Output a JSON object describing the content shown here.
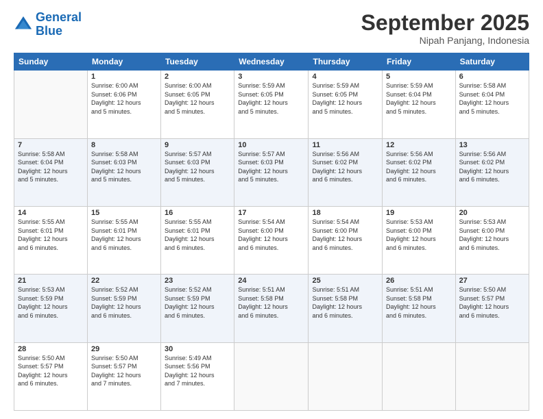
{
  "logo": {
    "text_general": "General",
    "text_blue": "Blue"
  },
  "header": {
    "month_year": "September 2025",
    "location": "Nipah Panjang, Indonesia"
  },
  "days_of_week": [
    "Sunday",
    "Monday",
    "Tuesday",
    "Wednesday",
    "Thursday",
    "Friday",
    "Saturday"
  ],
  "weeks": [
    [
      {
        "day": "",
        "info": ""
      },
      {
        "day": "1",
        "info": "Sunrise: 6:00 AM\nSunset: 6:06 PM\nDaylight: 12 hours\nand 5 minutes."
      },
      {
        "day": "2",
        "info": "Sunrise: 6:00 AM\nSunset: 6:05 PM\nDaylight: 12 hours\nand 5 minutes."
      },
      {
        "day": "3",
        "info": "Sunrise: 5:59 AM\nSunset: 6:05 PM\nDaylight: 12 hours\nand 5 minutes."
      },
      {
        "day": "4",
        "info": "Sunrise: 5:59 AM\nSunset: 6:05 PM\nDaylight: 12 hours\nand 5 minutes."
      },
      {
        "day": "5",
        "info": "Sunrise: 5:59 AM\nSunset: 6:04 PM\nDaylight: 12 hours\nand 5 minutes."
      },
      {
        "day": "6",
        "info": "Sunrise: 5:58 AM\nSunset: 6:04 PM\nDaylight: 12 hours\nand 5 minutes."
      }
    ],
    [
      {
        "day": "7",
        "info": "Sunrise: 5:58 AM\nSunset: 6:04 PM\nDaylight: 12 hours\nand 5 minutes."
      },
      {
        "day": "8",
        "info": "Sunrise: 5:58 AM\nSunset: 6:03 PM\nDaylight: 12 hours\nand 5 minutes."
      },
      {
        "day": "9",
        "info": "Sunrise: 5:57 AM\nSunset: 6:03 PM\nDaylight: 12 hours\nand 5 minutes."
      },
      {
        "day": "10",
        "info": "Sunrise: 5:57 AM\nSunset: 6:03 PM\nDaylight: 12 hours\nand 5 minutes."
      },
      {
        "day": "11",
        "info": "Sunrise: 5:56 AM\nSunset: 6:02 PM\nDaylight: 12 hours\nand 6 minutes."
      },
      {
        "day": "12",
        "info": "Sunrise: 5:56 AM\nSunset: 6:02 PM\nDaylight: 12 hours\nand 6 minutes."
      },
      {
        "day": "13",
        "info": "Sunrise: 5:56 AM\nSunset: 6:02 PM\nDaylight: 12 hours\nand 6 minutes."
      }
    ],
    [
      {
        "day": "14",
        "info": "Sunrise: 5:55 AM\nSunset: 6:01 PM\nDaylight: 12 hours\nand 6 minutes."
      },
      {
        "day": "15",
        "info": "Sunrise: 5:55 AM\nSunset: 6:01 PM\nDaylight: 12 hours\nand 6 minutes."
      },
      {
        "day": "16",
        "info": "Sunrise: 5:55 AM\nSunset: 6:01 PM\nDaylight: 12 hours\nand 6 minutes."
      },
      {
        "day": "17",
        "info": "Sunrise: 5:54 AM\nSunset: 6:00 PM\nDaylight: 12 hours\nand 6 minutes."
      },
      {
        "day": "18",
        "info": "Sunrise: 5:54 AM\nSunset: 6:00 PM\nDaylight: 12 hours\nand 6 minutes."
      },
      {
        "day": "19",
        "info": "Sunrise: 5:53 AM\nSunset: 6:00 PM\nDaylight: 12 hours\nand 6 minutes."
      },
      {
        "day": "20",
        "info": "Sunrise: 5:53 AM\nSunset: 6:00 PM\nDaylight: 12 hours\nand 6 minutes."
      }
    ],
    [
      {
        "day": "21",
        "info": "Sunrise: 5:53 AM\nSunset: 5:59 PM\nDaylight: 12 hours\nand 6 minutes."
      },
      {
        "day": "22",
        "info": "Sunrise: 5:52 AM\nSunset: 5:59 PM\nDaylight: 12 hours\nand 6 minutes."
      },
      {
        "day": "23",
        "info": "Sunrise: 5:52 AM\nSunset: 5:59 PM\nDaylight: 12 hours\nand 6 minutes."
      },
      {
        "day": "24",
        "info": "Sunrise: 5:51 AM\nSunset: 5:58 PM\nDaylight: 12 hours\nand 6 minutes."
      },
      {
        "day": "25",
        "info": "Sunrise: 5:51 AM\nSunset: 5:58 PM\nDaylight: 12 hours\nand 6 minutes."
      },
      {
        "day": "26",
        "info": "Sunrise: 5:51 AM\nSunset: 5:58 PM\nDaylight: 12 hours\nand 6 minutes."
      },
      {
        "day": "27",
        "info": "Sunrise: 5:50 AM\nSunset: 5:57 PM\nDaylight: 12 hours\nand 6 minutes."
      }
    ],
    [
      {
        "day": "28",
        "info": "Sunrise: 5:50 AM\nSunset: 5:57 PM\nDaylight: 12 hours\nand 6 minutes."
      },
      {
        "day": "29",
        "info": "Sunrise: 5:50 AM\nSunset: 5:57 PM\nDaylight: 12 hours\nand 7 minutes."
      },
      {
        "day": "30",
        "info": "Sunrise: 5:49 AM\nSunset: 5:56 PM\nDaylight: 12 hours\nand 7 minutes."
      },
      {
        "day": "",
        "info": ""
      },
      {
        "day": "",
        "info": ""
      },
      {
        "day": "",
        "info": ""
      },
      {
        "day": "",
        "info": ""
      }
    ]
  ]
}
